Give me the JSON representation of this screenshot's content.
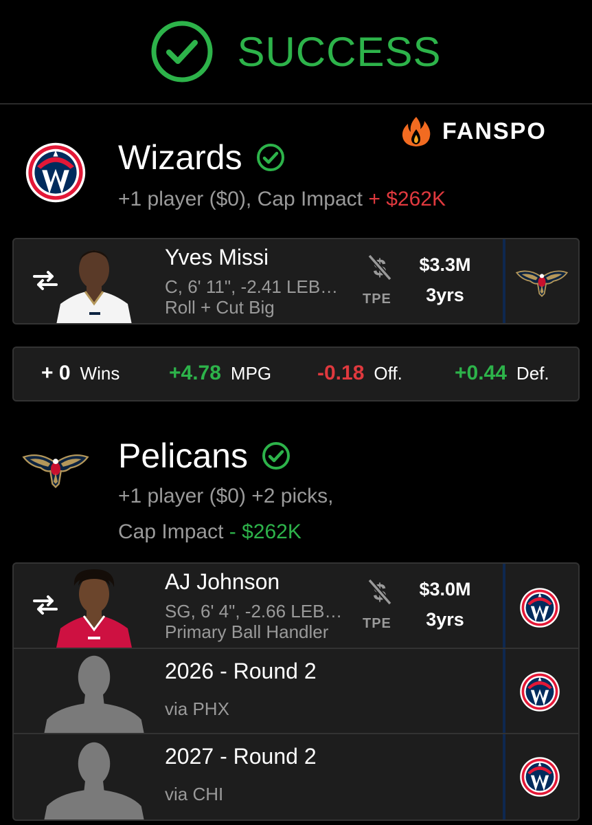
{
  "header": {
    "status": "SUCCESS"
  },
  "brand": {
    "name": "FANSPO"
  },
  "colors": {
    "green": "#2db34a",
    "red": "#e0393e",
    "wizards_navy": "#002b5c",
    "wizards_red": "#e31837",
    "pelicans_navy": "#0c2340",
    "pelicans_gold": "#b4975a"
  },
  "wizards": {
    "name": "Wizards",
    "summary_prefix": "+1 player ($0), Cap Impact",
    "cap_impact": "+ $262K",
    "players": [
      {
        "name": "Yves Missi",
        "desc": "C, 6' 11\", -2.41 LEB…",
        "role": "Roll + Cut Big",
        "tpe": "TPE",
        "salary": "$3.3M",
        "years": "3yrs",
        "from_icon": "pelicans-logo-icon"
      }
    ],
    "stats": [
      {
        "value": "+ 0",
        "label": "Wins"
      },
      {
        "value": "+4.78",
        "label": "MPG"
      },
      {
        "value": "-0.18",
        "label": "Off."
      },
      {
        "value": "+0.44",
        "label": "Def."
      }
    ]
  },
  "pelicans": {
    "name": "Pelicans",
    "summary_line1": "+1 player ($0) +2 picks,",
    "summary_prefix": "Cap Impact",
    "cap_impact": "- $262K",
    "players": [
      {
        "name": "AJ Johnson",
        "desc": "SG, 6' 4\", -2.66 LEB…",
        "role": "Primary Ball Handler",
        "tpe": "TPE",
        "salary": "$3.0M",
        "years": "3yrs",
        "from_icon": "wizards-logo-icon"
      }
    ],
    "picks": [
      {
        "name": "2026 - Round 2",
        "via": "via PHX",
        "from_icon": "wizards-logo-icon"
      },
      {
        "name": "2027 - Round 2",
        "via": "via CHI",
        "from_icon": "wizards-logo-icon"
      }
    ]
  }
}
